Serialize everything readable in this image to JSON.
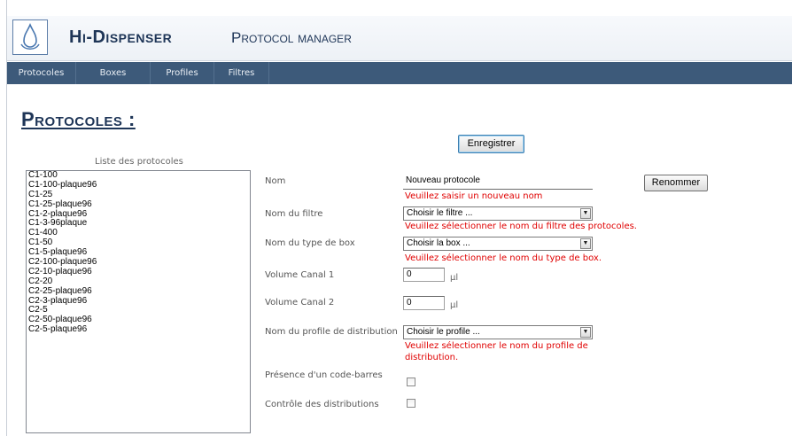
{
  "header": {
    "app_title": "Hi-Dispenser",
    "app_subtitle": "Protocol manager"
  },
  "nav": {
    "items": [
      "Protocoles",
      "Boxes",
      "Profiles",
      "Filtres"
    ]
  },
  "page": {
    "title": "Protocoles :",
    "save_label": "Enregistrer"
  },
  "protocol_list": {
    "caption": "Liste des protocoles",
    "items": [
      "C1-100",
      "C1-100-plaque96",
      "C1-25",
      "C1-25-plaque96",
      "C1-2-plaque96",
      "C1-3-96plaque",
      "C1-400",
      "C1-50",
      "C1-5-plaque96",
      "C2-100-plaque96",
      "C2-10-plaque96",
      "C2-20",
      "C2-25-plaque96",
      "C2-3-plaque96",
      "C2-5",
      "C2-50-plaque96",
      "C2-5-plaque96"
    ]
  },
  "form": {
    "name": {
      "label": "Nom",
      "value": "Nouveau protocole",
      "error": "Veuillez saisir un nouveau nom",
      "rename_label": "Renommer"
    },
    "filter": {
      "label": "Nom du filtre",
      "selected": "Choisir le filtre ...",
      "error": "Veuillez sélectionner le nom du filtre des protocoles."
    },
    "box": {
      "label": "Nom du type de box",
      "selected": "Choisir la box ...",
      "error": "Veuillez sélectionner le nom du type de box."
    },
    "volume1": {
      "label": "Volume Canal 1",
      "value": "0",
      "unit": "µl"
    },
    "volume2": {
      "label": "Volume Canal 2",
      "value": "0",
      "unit": "µl"
    },
    "profile": {
      "label": "Nom du profile de distribution",
      "selected": "Choisir le profile ...",
      "error_line1": "Veuillez sélectionner le nom du profile de",
      "error_line2": "distribution."
    },
    "barcode": {
      "label": "Présence d'un code-barres",
      "checked": false
    },
    "control": {
      "label": "Contrôle des distributions",
      "checked": false
    }
  },
  "colors": {
    "nav_bg": "#3d5a7a",
    "title": "#1e3557",
    "error": "#e00000"
  },
  "icons": {
    "logo": "water-drop-icon",
    "select_arrow": "chevron-down-icon"
  }
}
